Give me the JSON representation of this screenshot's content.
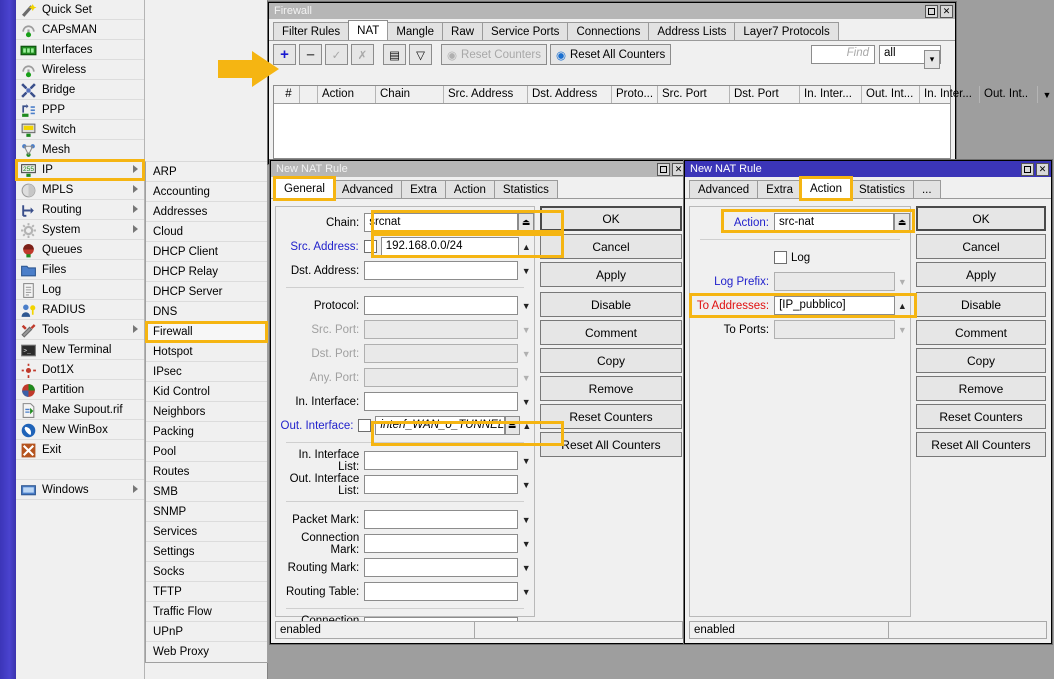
{
  "winbox_menu": {
    "items": [
      {
        "label": "Quick Set",
        "icon": "wand-icon",
        "submenu": false
      },
      {
        "label": "CAPsMAN",
        "icon": "antenna-icon",
        "submenu": false
      },
      {
        "label": "Interfaces",
        "icon": "interfaces-icon",
        "submenu": false
      },
      {
        "label": "Wireless",
        "icon": "wireless-icon",
        "submenu": false
      },
      {
        "label": "Bridge",
        "icon": "bridge-icon",
        "submenu": false
      },
      {
        "label": "PPP",
        "icon": "ppp-icon",
        "submenu": false
      },
      {
        "label": "Switch",
        "icon": "switch-icon",
        "submenu": false
      },
      {
        "label": "Mesh",
        "icon": "mesh-icon",
        "submenu": false
      },
      {
        "label": "IP",
        "icon": "ip-icon",
        "submenu": true,
        "highlighted": true
      },
      {
        "label": "MPLS",
        "icon": "mpls-icon",
        "submenu": true
      },
      {
        "label": "Routing",
        "icon": "routing-icon",
        "submenu": true
      },
      {
        "label": "System",
        "icon": "system-icon",
        "submenu": true
      },
      {
        "label": "Queues",
        "icon": "queues-icon",
        "submenu": false
      },
      {
        "label": "Files",
        "icon": "files-icon",
        "submenu": false
      },
      {
        "label": "Log",
        "icon": "log-icon",
        "submenu": false
      },
      {
        "label": "RADIUS",
        "icon": "radius-icon",
        "submenu": false
      },
      {
        "label": "Tools",
        "icon": "tools-icon",
        "submenu": true
      },
      {
        "label": "New Terminal",
        "icon": "terminal-icon",
        "submenu": false
      },
      {
        "label": "Dot1X",
        "icon": "dot1x-icon",
        "submenu": false
      },
      {
        "label": "Partition",
        "icon": "partition-icon",
        "submenu": false
      },
      {
        "label": "Make Supout.rif",
        "icon": "supout-icon",
        "submenu": false
      },
      {
        "label": "New WinBox",
        "icon": "winbox-icon",
        "submenu": false
      },
      {
        "label": "Exit",
        "icon": "exit-icon",
        "submenu": false
      },
      {
        "label": "",
        "icon": "",
        "submenu": false
      },
      {
        "label": "Windows",
        "icon": "windows-icon",
        "submenu": true
      }
    ]
  },
  "ip_submenu": {
    "items": [
      {
        "label": "ARP"
      },
      {
        "label": "Accounting"
      },
      {
        "label": "Addresses"
      },
      {
        "label": "Cloud"
      },
      {
        "label": "DHCP Client"
      },
      {
        "label": "DHCP Relay"
      },
      {
        "label": "DHCP Server"
      },
      {
        "label": "DNS"
      },
      {
        "label": "Firewall",
        "highlighted": true
      },
      {
        "label": "Hotspot"
      },
      {
        "label": "IPsec"
      },
      {
        "label": "Kid Control"
      },
      {
        "label": "Neighbors"
      },
      {
        "label": "Packing"
      },
      {
        "label": "Pool"
      },
      {
        "label": "Routes"
      },
      {
        "label": "SMB"
      },
      {
        "label": "SNMP"
      },
      {
        "label": "Services"
      },
      {
        "label": "Settings"
      },
      {
        "label": "Socks"
      },
      {
        "label": "TFTP"
      },
      {
        "label": "Traffic Flow"
      },
      {
        "label": "UPnP"
      },
      {
        "label": "Web Proxy"
      }
    ]
  },
  "firewall_window": {
    "title": "Firewall",
    "tabs": [
      {
        "label": "Filter Rules",
        "active": false
      },
      {
        "label": "NAT",
        "active": true
      },
      {
        "label": "Mangle",
        "active": false
      },
      {
        "label": "Raw",
        "active": false
      },
      {
        "label": "Service Ports",
        "active": false
      },
      {
        "label": "Connections",
        "active": false
      },
      {
        "label": "Address Lists",
        "active": false
      },
      {
        "label": "Layer7 Protocols",
        "active": false
      }
    ],
    "toolbar": {
      "add_label": "+",
      "remove_label": "–",
      "enable_label": "✓",
      "disable_label": "✗",
      "comment_label": "▤",
      "filter_label": "▽",
      "reset_counters": "Reset Counters",
      "reset_all_counters": "Reset All Counters",
      "find_placeholder": "Find",
      "scope_value": "all"
    },
    "columns": [
      "#",
      "",
      "Action",
      "Chain",
      "Src. Address",
      "Dst. Address",
      "Proto...",
      "Src. Port",
      "Dst. Port",
      "In. Inter...",
      "Out. Int...",
      "In. Inter...",
      "Out. Int.."
    ],
    "rows": []
  },
  "nat_left": {
    "title": "New NAT Rule",
    "tabs": [
      {
        "label": "General",
        "active": true,
        "highlighted": true
      },
      {
        "label": "Advanced",
        "active": false
      },
      {
        "label": "Extra",
        "active": false
      },
      {
        "label": "Action",
        "active": false
      },
      {
        "label": "Statistics",
        "active": false
      }
    ],
    "fields": [
      {
        "label": "Chain:",
        "value": "srcnat",
        "checkbox": false,
        "disabled": false,
        "control": "spin",
        "highlighted": true
      },
      {
        "label": "Src. Address:",
        "value": "192.168.0.0/24",
        "checkbox": true,
        "disabled": false,
        "control": "up",
        "label_color": "blue",
        "highlighted": true
      },
      {
        "label": "Dst. Address:",
        "value": "",
        "checkbox": false,
        "disabled": false,
        "control": "down"
      },
      {
        "label": "Protocol:",
        "value": "",
        "checkbox": false,
        "disabled": false,
        "control": "down"
      },
      {
        "label": "Src. Port:",
        "value": "",
        "checkbox": false,
        "disabled": true,
        "control": "down"
      },
      {
        "label": "Dst. Port:",
        "value": "",
        "checkbox": false,
        "disabled": true,
        "control": "down"
      },
      {
        "label": "Any. Port:",
        "value": "",
        "checkbox": false,
        "disabled": true,
        "control": "down"
      },
      {
        "label": "In. Interface:",
        "value": "",
        "checkbox": false,
        "disabled": false,
        "control": "down"
      },
      {
        "label": "Out. Interface:",
        "value": "interf_WAN_o_TUNNEL",
        "checkbox": true,
        "disabled": false,
        "control": "spinup",
        "label_color": "blue",
        "italic": true,
        "highlighted": true
      },
      {
        "label": "In. Interface List:",
        "value": "",
        "checkbox": false,
        "disabled": false,
        "control": "down"
      },
      {
        "label": "Out. Interface List:",
        "value": "",
        "checkbox": false,
        "disabled": false,
        "control": "down"
      },
      {
        "label": "Packet Mark:",
        "value": "",
        "checkbox": false,
        "disabled": false,
        "control": "down"
      },
      {
        "label": "Connection Mark:",
        "value": "",
        "checkbox": false,
        "disabled": false,
        "control": "down"
      },
      {
        "label": "Routing Mark:",
        "value": "",
        "checkbox": false,
        "disabled": false,
        "control": "down"
      },
      {
        "label": "Routing Table:",
        "value": "",
        "checkbox": false,
        "disabled": false,
        "control": "down"
      },
      {
        "label": "Connection Type:",
        "value": "",
        "checkbox": false,
        "disabled": false,
        "control": "down"
      }
    ],
    "buttons": [
      "OK",
      "Cancel",
      "Apply",
      "Disable",
      "Comment",
      "Copy",
      "Remove",
      "Reset Counters",
      "Reset All Counters"
    ],
    "status": "enabled"
  },
  "nat_right": {
    "title": "New NAT Rule",
    "tabs": [
      {
        "label": "Advanced",
        "active": false
      },
      {
        "label": "Extra",
        "active": false
      },
      {
        "label": "Action",
        "active": true,
        "highlighted": true
      },
      {
        "label": "Statistics",
        "active": false
      },
      {
        "label": "...",
        "active": false
      }
    ],
    "fields": [
      {
        "label": "Action:",
        "value": "src-nat",
        "control": "spin",
        "label_color": "blue",
        "highlighted": true
      },
      {
        "label": "Log",
        "value": "",
        "control": "checkbox-only"
      },
      {
        "label": "Log Prefix:",
        "value": "",
        "control": "down",
        "label_color": "blue",
        "disabled": true
      },
      {
        "label": "To Addresses:",
        "value": "[IP_pubblico]",
        "control": "up",
        "label_color": "red",
        "highlighted": true
      },
      {
        "label": "To Ports:",
        "value": "",
        "control": "down",
        "disabled": true
      }
    ],
    "buttons": [
      "OK",
      "Cancel",
      "Apply",
      "Disable",
      "Comment",
      "Copy",
      "Remove",
      "Reset Counters",
      "Reset All Counters"
    ],
    "status": "enabled"
  },
  "annotation": {
    "arrow_color": "#F5B512",
    "highlight_color": "#F5B512",
    "arrow_target": "add-nat-rule-button"
  }
}
